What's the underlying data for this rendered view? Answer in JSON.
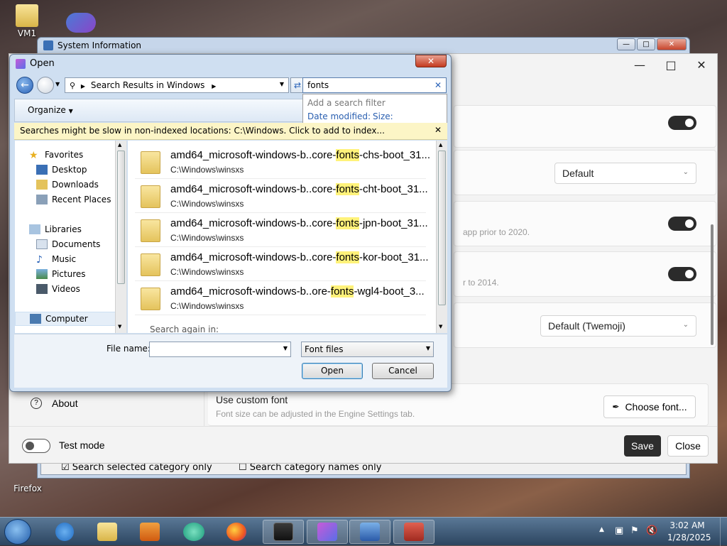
{
  "desktop": {
    "icons": [
      {
        "label": "VM1",
        "icon": "folder-user-icon"
      },
      {
        "label": "",
        "icon": "infinity-app-icon"
      },
      {
        "label": "Firefox",
        "icon": "firefox-icon"
      }
    ]
  },
  "sysinfo_window": {
    "title": "System Information",
    "footer_left": "Search selected category only",
    "footer_right": "Search category names only"
  },
  "settings_window": {
    "emoji_select": "Default",
    "text_1": "app prior to 2020.",
    "text_2": "r to 2014.",
    "emoji_font_select": "Default (Twemoji)",
    "about_label": "About",
    "custom_font_title": "Use custom font",
    "custom_font_desc": "Font size can be adjusted in the Engine Settings tab.",
    "choose_font_label": "Choose font...",
    "test_mode_label": "Test mode",
    "save_label": "Save",
    "close_label": "Close"
  },
  "dialog": {
    "title": "Open",
    "address": "Search Results in Windows",
    "search_value": "fonts",
    "filter_hint": "Add a search filter",
    "filter_date": "Date modified:",
    "filter_size": "Size:",
    "organize_label": "Organize",
    "info_message": "Searches might be slow in non-indexed locations: C:\\Windows. Click to add to index...",
    "nav": {
      "favorites": "Favorites",
      "desktop": "Desktop",
      "downloads": "Downloads",
      "recent": "Recent Places",
      "libraries": "Libraries",
      "documents": "Documents",
      "music": "Music",
      "pictures": "Pictures",
      "videos": "Videos",
      "computer": "Computer"
    },
    "files": [
      {
        "pre": "amd64_microsoft-windows-b..core-",
        "hl": "fonts",
        "post": "-chs-boot_31...",
        "path": "C:\\Windows\\winsxs"
      },
      {
        "pre": "amd64_microsoft-windows-b..core-",
        "hl": "fonts",
        "post": "-cht-boot_31...",
        "path": "C:\\Windows\\winsxs"
      },
      {
        "pre": "amd64_microsoft-windows-b..core-",
        "hl": "fonts",
        "post": "-jpn-boot_31...",
        "path": "C:\\Windows\\winsxs"
      },
      {
        "pre": "amd64_microsoft-windows-b..core-",
        "hl": "fonts",
        "post": "-kor-boot_31...",
        "path": "C:\\Windows\\winsxs"
      },
      {
        "pre": "amd64_microsoft-windows-b..ore-",
        "hl": "fonts",
        "post": "-wgl4-boot_3...",
        "path": "C:\\Windows\\winsxs"
      }
    ],
    "search_again": "Search again in:",
    "file_name_label": "File name:",
    "file_name_value": "",
    "file_type": "Font files",
    "open_label": "Open",
    "cancel_label": "Cancel"
  },
  "taskbar": {
    "time": "3:02 AM",
    "date": "1/28/2025"
  }
}
